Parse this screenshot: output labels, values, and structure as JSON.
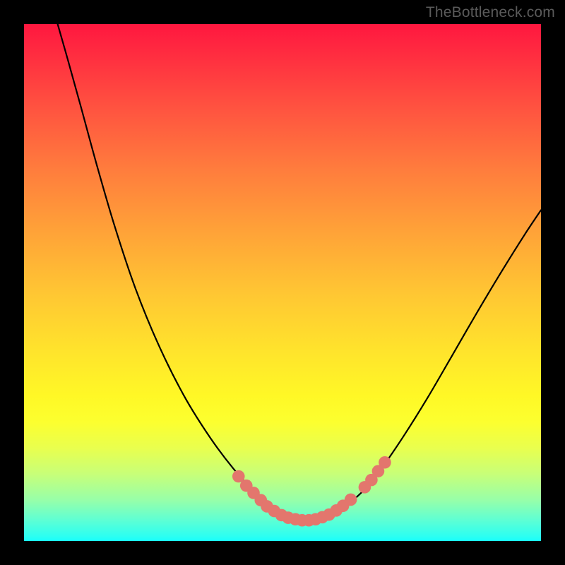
{
  "watermark": {
    "text": "TheBottleneck.com"
  },
  "chart_data": {
    "type": "line",
    "title": "",
    "xlabel": "",
    "ylabel": "",
    "xlim": [
      0,
      732
    ],
    "ylim": [
      0,
      732
    ],
    "grid": false,
    "series": [
      {
        "name": "curve",
        "stroke": "#000",
        "stroke_width": 2.2,
        "path_norm": [
          [
            0.065,
            0.0
          ],
          [
            0.085,
            0.07
          ],
          [
            0.11,
            0.16
          ],
          [
            0.14,
            0.27
          ],
          [
            0.175,
            0.39
          ],
          [
            0.215,
            0.51
          ],
          [
            0.26,
            0.62
          ],
          [
            0.31,
            0.72
          ],
          [
            0.36,
            0.8
          ],
          [
            0.405,
            0.86
          ],
          [
            0.448,
            0.907
          ],
          [
            0.488,
            0.941
          ],
          [
            0.52,
            0.955
          ],
          [
            0.553,
            0.958
          ],
          [
            0.586,
            0.951
          ],
          [
            0.62,
            0.933
          ],
          [
            0.656,
            0.903
          ],
          [
            0.694,
            0.856
          ],
          [
            0.735,
            0.796
          ],
          [
            0.78,
            0.724
          ],
          [
            0.826,
            0.645
          ],
          [
            0.874,
            0.562
          ],
          [
            0.923,
            0.48
          ],
          [
            0.968,
            0.408
          ],
          [
            1.0,
            0.36
          ]
        ]
      }
    ],
    "markers": {
      "name": "highlight-dots",
      "fill": "#e3766d",
      "r": 8.8,
      "points_norm": [
        [
          0.415,
          0.875
        ],
        [
          0.43,
          0.893
        ],
        [
          0.444,
          0.907
        ],
        [
          0.458,
          0.921
        ],
        [
          0.47,
          0.933
        ],
        [
          0.484,
          0.942
        ],
        [
          0.498,
          0.95
        ],
        [
          0.511,
          0.955
        ],
        [
          0.525,
          0.958
        ],
        [
          0.538,
          0.96
        ],
        [
          0.551,
          0.96
        ],
        [
          0.564,
          0.958
        ],
        [
          0.577,
          0.954
        ],
        [
          0.59,
          0.949
        ],
        [
          0.604,
          0.941
        ],
        [
          0.617,
          0.932
        ],
        [
          0.632,
          0.92
        ],
        [
          0.659,
          0.896
        ],
        [
          0.672,
          0.882
        ],
        [
          0.685,
          0.865
        ],
        [
          0.698,
          0.848
        ]
      ]
    }
  }
}
